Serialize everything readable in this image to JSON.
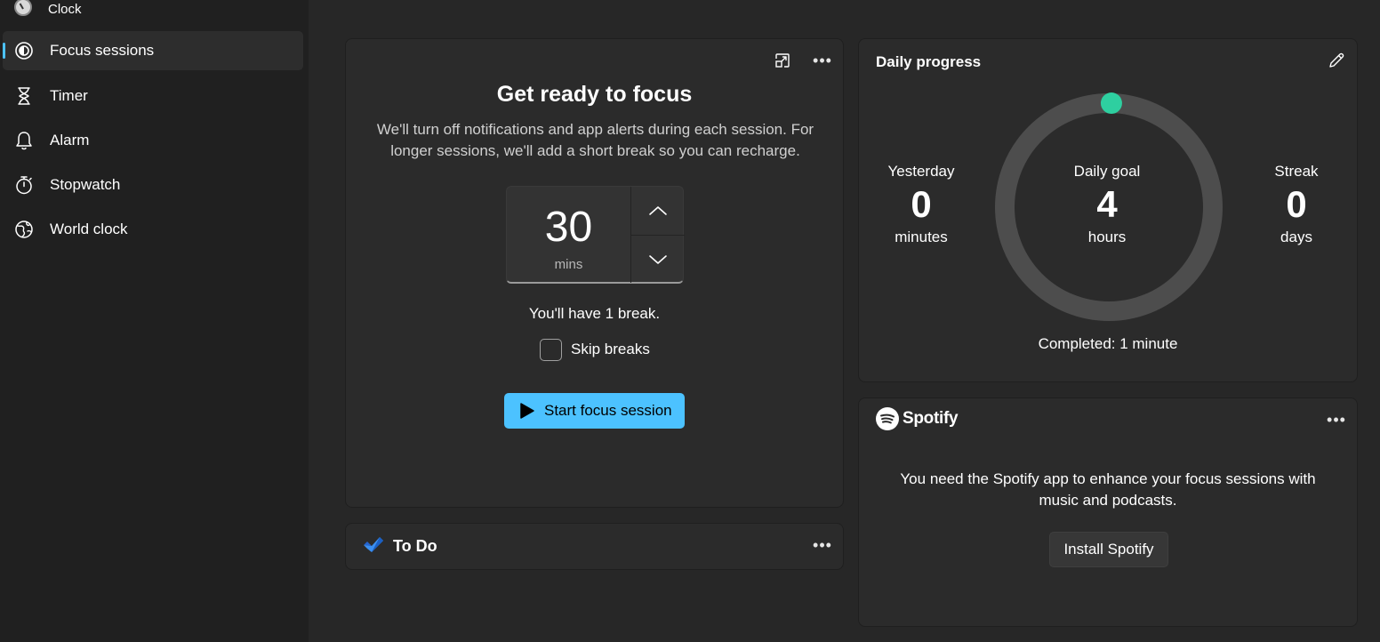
{
  "app": {
    "title": "Clock"
  },
  "sidebar": {
    "items": [
      {
        "label": "Focus sessions",
        "icon": "focus-icon",
        "active": true
      },
      {
        "label": "Timer",
        "icon": "hourglass-icon",
        "active": false
      },
      {
        "label": "Alarm",
        "icon": "bell-icon",
        "active": false
      },
      {
        "label": "Stopwatch",
        "icon": "stopwatch-icon",
        "active": false
      },
      {
        "label": "World clock",
        "icon": "globe-icon",
        "active": false
      }
    ]
  },
  "focus": {
    "title": "Get ready to focus",
    "description": "We'll turn off notifications and app alerts during each session. For longer sessions, we'll add a short break so you can recharge.",
    "minutes_value": "30",
    "minutes_unit": "mins",
    "break_text": "You'll have 1 break.",
    "skip_breaks_label": "Skip breaks",
    "skip_breaks_checked": false,
    "start_label": "Start focus session"
  },
  "todo": {
    "title": "To Do"
  },
  "progress": {
    "title": "Daily progress",
    "yesterday": {
      "label": "Yesterday",
      "value": "0",
      "unit": "minutes"
    },
    "goal": {
      "label": "Daily goal",
      "value": "4",
      "unit": "hours"
    },
    "streak": {
      "label": "Streak",
      "value": "0",
      "unit": "days"
    },
    "completed_text": "Completed: 1 minute",
    "completed_fraction": 0.004
  },
  "spotify": {
    "brand": "Spotify",
    "message": "You need the Spotify app to enhance your focus sessions with music and podcasts.",
    "install_label": "Install Spotify"
  },
  "colors": {
    "accent": "#4cc2ff",
    "progress_dot": "#2ecfa0",
    "ring_track": "#4d4d4d"
  }
}
